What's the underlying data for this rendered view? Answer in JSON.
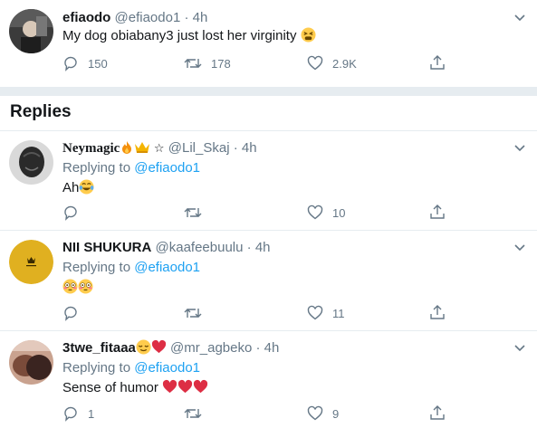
{
  "main_tweet": {
    "name": "efiaodo",
    "handle": "@efiaodo1",
    "time": "4h",
    "text": "My dog obiabany3 just lost her virginity",
    "replies": "150",
    "retweets": "178",
    "likes": "2.9K"
  },
  "section": {
    "title": "Replies"
  },
  "replies": [
    {
      "name": "Neymagic",
      "handle": "@Lil_Skaj",
      "time": "4h",
      "replying_prefix": "Replying to",
      "replying_to": "@efiaodo1",
      "text": "Ah",
      "replies": "",
      "retweets": "",
      "likes": "10",
      "avatar_color": "#222222"
    },
    {
      "name": "NII SHUKURA",
      "handle": "@kaafeebuulu",
      "time": "4h",
      "replying_prefix": "Replying to",
      "replying_to": "@efiaodo1",
      "text": "",
      "replies": "",
      "retweets": "",
      "likes": "11",
      "avatar_color": "#e0b020"
    },
    {
      "name": "3twe_fitaaa",
      "handle": "@mr_agbeko",
      "time": "4h",
      "replying_prefix": "Replying to",
      "replying_to": "@efiaodo1",
      "text": "Sense of humor",
      "replies": "1",
      "retweets": "",
      "likes": "9",
      "avatar_color": "#7a4b3a"
    }
  ],
  "colors": {
    "accent": "#1da1f2",
    "muted": "#657786",
    "divider": "#e6ecf0",
    "heart": "#e0245e"
  }
}
